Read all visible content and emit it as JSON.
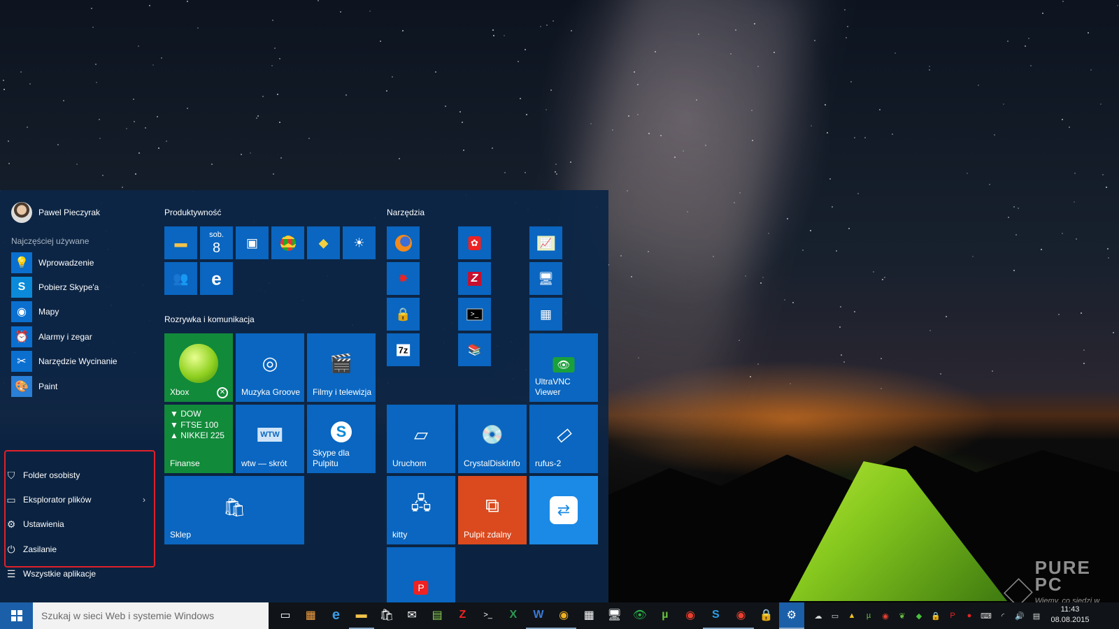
{
  "user": {
    "name": "Pawel Pieczyrak"
  },
  "recent": {
    "label": "Najczęściej używane",
    "items": [
      {
        "label": "Wprowadzenie",
        "icon": "lightbulb-icon"
      },
      {
        "label": "Pobierz Skype'a",
        "icon": "skype-icon"
      },
      {
        "label": "Mapy",
        "icon": "maps-icon"
      },
      {
        "label": "Alarmy i zegar",
        "icon": "alarm-clock-icon"
      },
      {
        "label": "Narzędzie Wycinanie",
        "icon": "scissors-icon"
      },
      {
        "label": "Paint",
        "icon": "paint-palette-icon"
      }
    ]
  },
  "bottom": {
    "folder_label": "Folder osobisty",
    "explorer_label": "Eksplorator plików",
    "settings_label": "Ustawienia",
    "power_label": "Zasilanie",
    "all_apps_label": "Wszystkie aplikacje"
  },
  "groups": {
    "productivity": "Produktywność",
    "entertainment": "Rozrywka i komunikacja",
    "tools": "Narzędzia"
  },
  "calendar": {
    "day_name": "sob.",
    "day_number": "8"
  },
  "tiles": {
    "xbox": "Xbox",
    "groove": "Muzyka Groove",
    "movies": "Filmy i telewizja",
    "finance": "Finanse",
    "wtw": "wtw — skrót",
    "skype_desktop": "Skype dla Pulpitu",
    "store": "Sklep",
    "ultravnc": "UltraVNC Viewer",
    "run": "Uruchom",
    "crystal": "CrystalDiskInfo",
    "rufus": "rufus-2",
    "kitty": "kitty",
    "remote": "Pulpit zdalny"
  },
  "finance_ticker": [
    "▼ DOW",
    "▼ FTSE 100",
    "▲ NIKKEI 225"
  ],
  "search": {
    "placeholder": "Szukaj w sieci Web i systemie Windows"
  },
  "clock": {
    "time": "11:43",
    "date": "08.08.2015"
  },
  "watermark": {
    "brand": "PURE PC",
    "tagline": "Wiemy, co siedzi w sieci!"
  },
  "colors": {
    "tile_blue": "#0a66c0",
    "xbox_green": "#118a3a",
    "remote_orange": "#da4a1e",
    "teamviewer_blue": "#1b8ae6",
    "highlight_red": "#e0202a"
  }
}
